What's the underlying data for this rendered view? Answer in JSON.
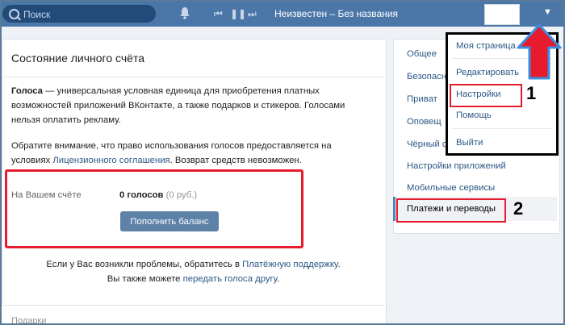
{
  "topbar": {
    "search_placeholder": "Поиск",
    "track": "Неизвестен – Без названия"
  },
  "panel": {
    "title": "Состояние личного счёта",
    "para1_bold": "Голоса",
    "para1_a": " — универсальная условная единица для приобретения платных",
    "para1_b": "возможностей приложений ВКонтакте, а также подарков и стикеров. Голосами",
    "para1_c": "нельзя оплатить рекламу.",
    "para2_a": "Обратите внимание, что право использования голосов предоставляется на",
    "para2_b_pre": "условиях ",
    "para2_b_link": "Лицензионного соглашения",
    "para2_b_post": ". Возврат средств невозможен.",
    "balance_label": "На Вашем счёте",
    "balance_value": "0 голосов",
    "balance_rub": "(0 руб.)",
    "topup_button": "Пополнить баланс",
    "help1_pre": "Если у Вас возникли проблемы, обратитесь в ",
    "help1_link": "Платёжную поддержку",
    "help1_post": ".",
    "help2_pre": "Вы также можете ",
    "help2_link": "передать голоса другу",
    "help2_post": ".",
    "bottom_text": "Подарки"
  },
  "right_menu": {
    "items": [
      "Общее",
      "Безопасн",
      "Приват",
      "Оповещ",
      "Чёрный с",
      "Настройки приложений",
      "Мобильные сервисы"
    ],
    "active": "Платежи и переводы"
  },
  "dropdown": {
    "items": [
      "Моя страница",
      "Редактировать",
      "Настройки",
      "Помощь",
      "Выйти"
    ]
  },
  "annotations": {
    "n1": "1",
    "n2": "2"
  }
}
